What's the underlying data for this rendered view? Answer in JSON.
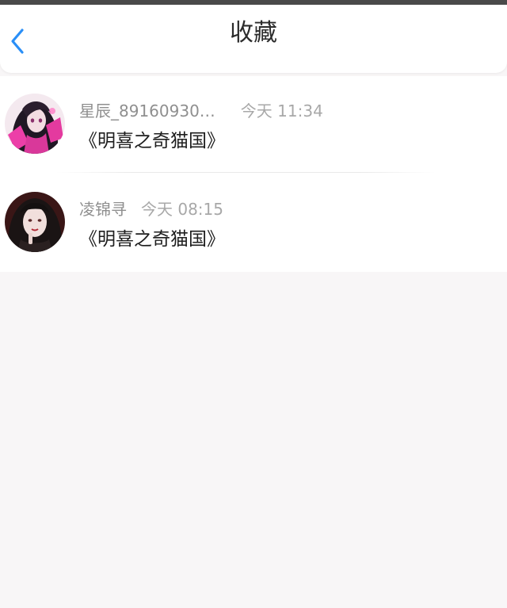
{
  "header": {
    "title": "收藏",
    "back_icon": "chevron-left-icon",
    "accent_color": "#2a8ff7"
  },
  "favorites": [
    {
      "username": "星辰_89160930…",
      "timestamp": "今天 11:34",
      "book_title": "《明喜之奇猫国》",
      "avatar": "avatar-pink-haired-girl"
    },
    {
      "username": "凌锦寻",
      "timestamp": "今天 08:15",
      "book_title": "《明喜之奇猫国》",
      "avatar": "avatar-dark-haired-girl"
    }
  ]
}
